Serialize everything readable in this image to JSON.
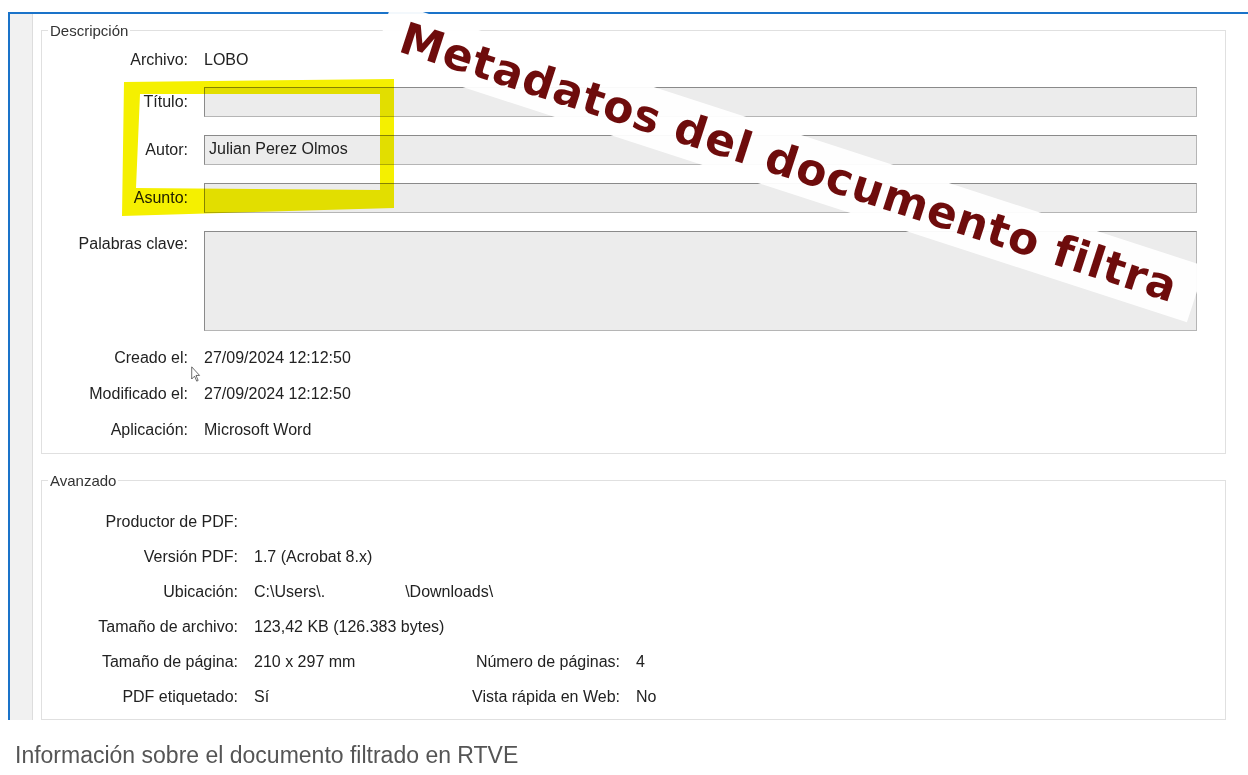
{
  "banner": {
    "text": "Metadatos del documento filtra"
  },
  "dialog": {
    "description": {
      "title": "Descripción",
      "file": {
        "label": "Archivo:",
        "value": "LOBO"
      },
      "fields": [
        {
          "label": "Título:",
          "kind": "line"
        },
        {
          "label": "Autor:",
          "kind": "line",
          "value": "Julian Perez Olmos"
        },
        {
          "label": "Asunto:",
          "kind": "line"
        },
        {
          "label": "Palabras clave:",
          "kind": "area"
        }
      ],
      "info": [
        {
          "label": "Creado el:",
          "value": "27/09/2024 12:12:50"
        },
        {
          "label": "Modificado el:",
          "value": "27/09/2024 12:12:50"
        },
        {
          "label": "Aplicación:",
          "value": "Microsoft Word"
        }
      ]
    },
    "advanced": {
      "title": "Avanzado",
      "rows": [
        {
          "items": [
            {
              "label": "Productor de PDF:"
            }
          ]
        },
        {
          "items": [
            {
              "label": "Versión PDF:",
              "value": "1.7 (Acrobat 8.x)"
            }
          ]
        },
        {
          "items": [
            {
              "label": "Ubicación:",
              "value": "C:\\Users\\.                  \\Downloads\\"
            }
          ]
        },
        {
          "items": [
            {
              "label": "Tamaño de archivo:",
              "value": "123,42 KB (126.383 bytes)"
            }
          ]
        },
        {
          "items": [
            {
              "label": "Tamaño de página:",
              "value": "210 x 297 mm"
            },
            {
              "label": "Número de páginas:",
              "value": "4"
            }
          ]
        },
        {
          "items": [
            {
              "label": "PDF etiquetado:",
              "value": "Sí"
            },
            {
              "label": "Vista rápida en Web:",
              "value": "No"
            }
          ]
        }
      ]
    }
  },
  "caption": "Información sobre el documento filtrado en RTVE"
}
